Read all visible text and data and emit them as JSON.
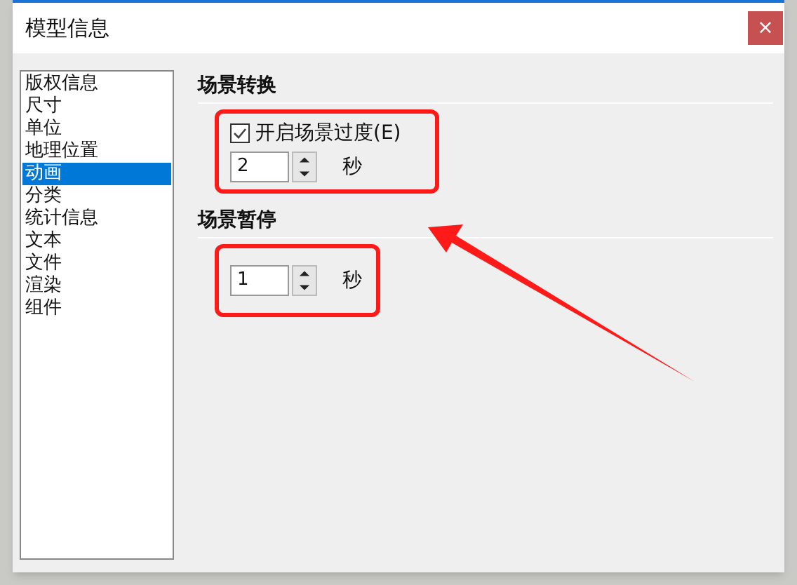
{
  "window": {
    "title": "模型信息",
    "close": "×"
  },
  "sidebar": {
    "items": [
      {
        "label": "版权信息",
        "selected": false
      },
      {
        "label": "尺寸",
        "selected": false
      },
      {
        "label": "单位",
        "selected": false
      },
      {
        "label": "地理位置",
        "selected": false
      },
      {
        "label": "动画",
        "selected": true
      },
      {
        "label": "分类",
        "selected": false
      },
      {
        "label": "统计信息",
        "selected": false
      },
      {
        "label": "文本",
        "selected": false
      },
      {
        "label": "文件",
        "selected": false
      },
      {
        "label": "渲染",
        "selected": false
      },
      {
        "label": "组件",
        "selected": false
      }
    ]
  },
  "sections": [
    {
      "title": "场景转换",
      "rows": [
        {
          "kind": "checkbox",
          "label": "开启场景过度(E)",
          "checked": true
        },
        {
          "kind": "spinner",
          "value": "2",
          "unit": "秒"
        }
      ]
    },
    {
      "title": "场景暂停",
      "rows": [
        {
          "kind": "spinner",
          "value": "1",
          "unit": "秒"
        }
      ]
    }
  ]
}
